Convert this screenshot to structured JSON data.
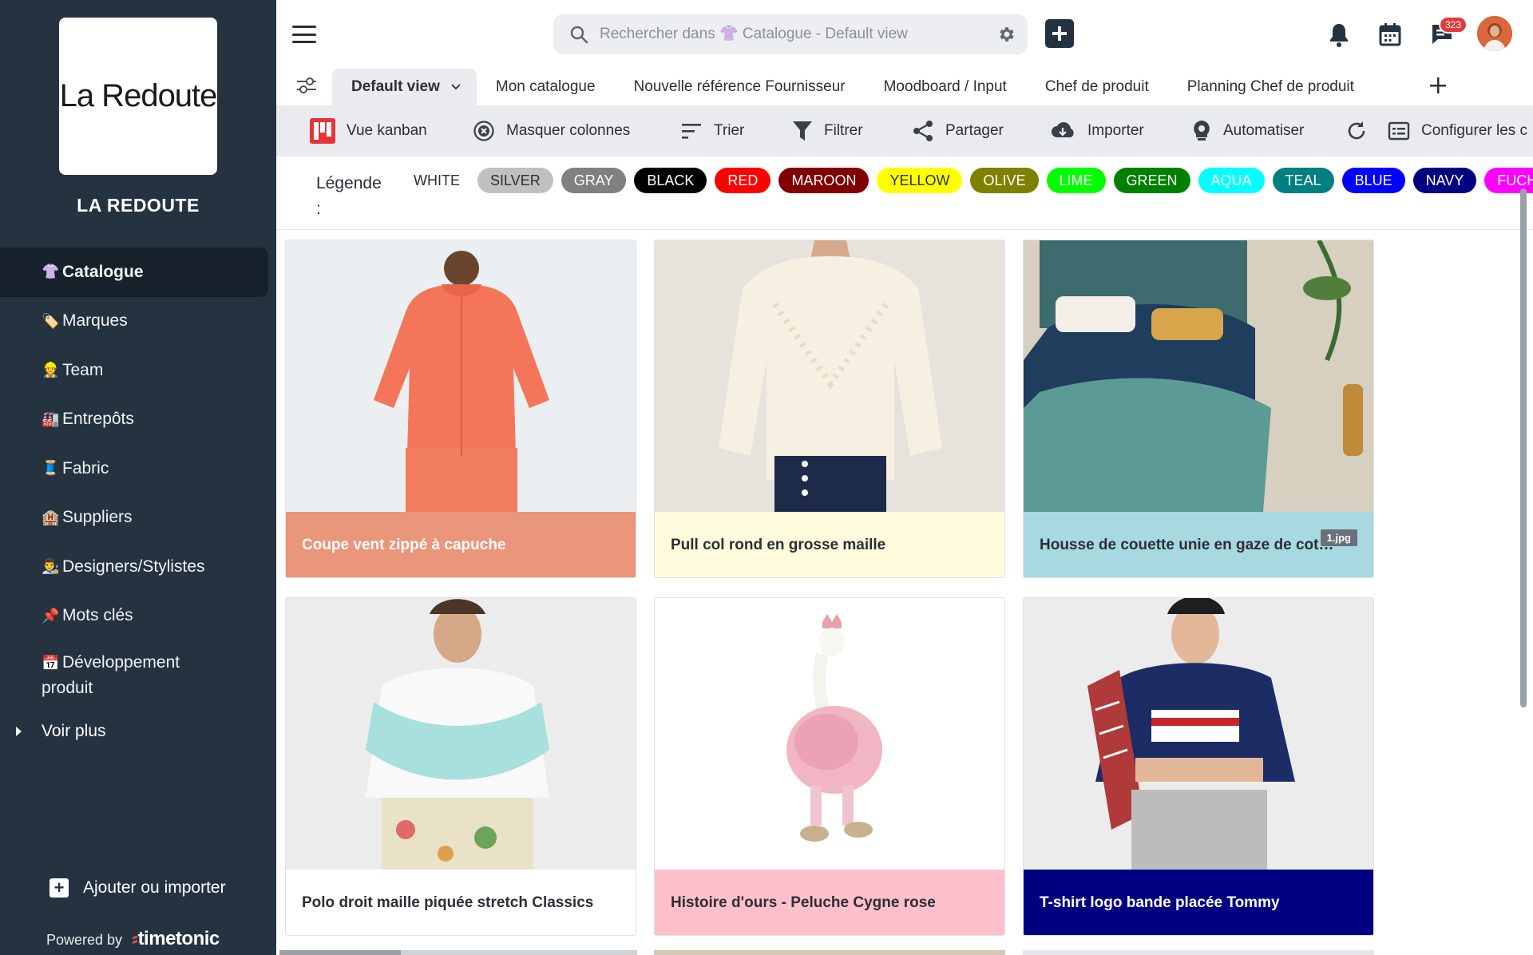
{
  "sidebar": {
    "logo_text": "La Redoute",
    "workspace_name": "LA REDOUTE",
    "items": [
      {
        "emoji": "👚",
        "label": "Catalogue",
        "active": true
      },
      {
        "emoji": "🏷️",
        "label": "Marques"
      },
      {
        "emoji": "👷",
        "label": "Team"
      },
      {
        "emoji": "🏭",
        "label": "Entrepôts"
      },
      {
        "emoji": "🧵",
        "label": "Fabric"
      },
      {
        "emoji": "🏨",
        "label": "Suppliers"
      },
      {
        "emoji": "👨‍🎨",
        "label": "Designers/Stylistes"
      },
      {
        "emoji": "📌",
        "label": "Mots clés"
      },
      {
        "emoji": "📅",
        "label": "Développement produit"
      }
    ],
    "more_label": "Voir plus",
    "add_import_label": "Ajouter ou importer",
    "powered_by": "Powered by",
    "brand": "timetonic"
  },
  "topbar": {
    "search_placeholder": "Rechercher dans 👚 Catalogue - Default view",
    "notification_count": "323"
  },
  "tabs": [
    {
      "label": "Default view",
      "active": true
    },
    {
      "label": "Mon catalogue"
    },
    {
      "label": "Nouvelle référence Fournisseur"
    },
    {
      "label": "Moodboard / Input"
    },
    {
      "label": "Chef de produit"
    },
    {
      "label": "Planning Chef de produit"
    }
  ],
  "toolbar": {
    "kanban": "Vue kanban",
    "hide_columns": "Masquer colonnes",
    "sort": "Trier",
    "filter": "Filtrer",
    "share": "Partager",
    "import": "Importer",
    "automate": "Automatiser",
    "configure": "Configurer les c"
  },
  "legend": {
    "label": "Légende :",
    "chips": [
      {
        "label": "WHITE",
        "bg": "#ffffff",
        "fg": "#2b2f36"
      },
      {
        "label": "SILVER",
        "bg": "#c0c0c0",
        "fg": "#2b2f36"
      },
      {
        "label": "GRAY",
        "bg": "#808080",
        "fg": "#ffffff"
      },
      {
        "label": "BLACK",
        "bg": "#000000",
        "fg": "#ffffff"
      },
      {
        "label": "RED",
        "bg": "#ff0000",
        "fg": "#ffffff"
      },
      {
        "label": "MAROON",
        "bg": "#800000",
        "fg": "#ffffff"
      },
      {
        "label": "YELLOW",
        "bg": "#ffff00",
        "fg": "#2b2f36"
      },
      {
        "label": "OLIVE",
        "bg": "#808000",
        "fg": "#ffffff"
      },
      {
        "label": "LIME",
        "bg": "#00ff00",
        "fg": "#ffffff"
      },
      {
        "label": "GREEN",
        "bg": "#008000",
        "fg": "#ffffff"
      },
      {
        "label": "AQUA",
        "bg": "#00ffff",
        "fg": "#ffffff"
      },
      {
        "label": "TEAL",
        "bg": "#008080",
        "fg": "#ffffff"
      },
      {
        "label": "BLUE",
        "bg": "#0000ff",
        "fg": "#ffffff"
      },
      {
        "label": "NAVY",
        "bg": "#000080",
        "fg": "#ffffff"
      },
      {
        "label": "FUCHSIA",
        "bg": "#ff00ff",
        "fg": "#ffffff"
      }
    ]
  },
  "cards": [
    {
      "title": "Coupe vent zippé à capuche",
      "footer_bg": "#e9967a",
      "footer_fg": "#ffffff",
      "image": "orange-hoodie-photo"
    },
    {
      "title": "Pull col rond en grosse maille",
      "footer_bg": "#fffbdc",
      "footer_fg": "#2b2f36",
      "image": "cream-sweater-photo"
    },
    {
      "title": "Housse de couette unie en gaze de coton",
      "footer_bg": "#a8d8e0",
      "footer_fg": "#2b2f36",
      "image": "bedding-photo",
      "file_label": "1.jpg"
    },
    {
      "title": "Polo droit maille piquée stretch Classics",
      "footer_bg": "#ffffff",
      "footer_fg": "#2b2f36",
      "image": "polo-model-photo"
    },
    {
      "title": "Histoire d'ours - Peluche Cygne rose",
      "footer_bg": "#ffc0cb",
      "footer_fg": "#2b2f36",
      "image": "swan-plush-photo"
    },
    {
      "title": "T-shirt logo bande placée Tommy",
      "footer_bg": "#000080",
      "footer_fg": "#ffffff",
      "image": "tshirt-model-photo"
    }
  ]
}
